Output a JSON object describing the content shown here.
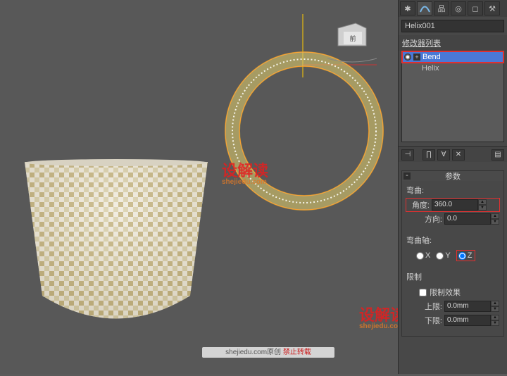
{
  "object_name": "Helix001",
  "modifier_list_label": "修改器列表",
  "modifiers": {
    "bend": "Bend",
    "helix": "Helix"
  },
  "rollup": {
    "title": "参数",
    "bend_group": "弯曲:",
    "angle_label": "角度:",
    "angle_value": "360.0",
    "direction_label": "方向:",
    "direction_value": "0.0",
    "axis_group": "弯曲轴:",
    "axis_x": "X",
    "axis_y": "Y",
    "axis_z": "Z",
    "limit_group": "限制",
    "limit_effect": "限制效果",
    "upper_label": "上限:",
    "upper_value": "0.0mm",
    "lower_label": "下限:",
    "lower_value": "0.0mm"
  },
  "watermark": {
    "main": "设解读",
    "sub": "shejiedu.com"
  },
  "footer": {
    "text1": "shejiedu.com原创 ",
    "text2": "禁止转载"
  },
  "viewcube_label": "前"
}
